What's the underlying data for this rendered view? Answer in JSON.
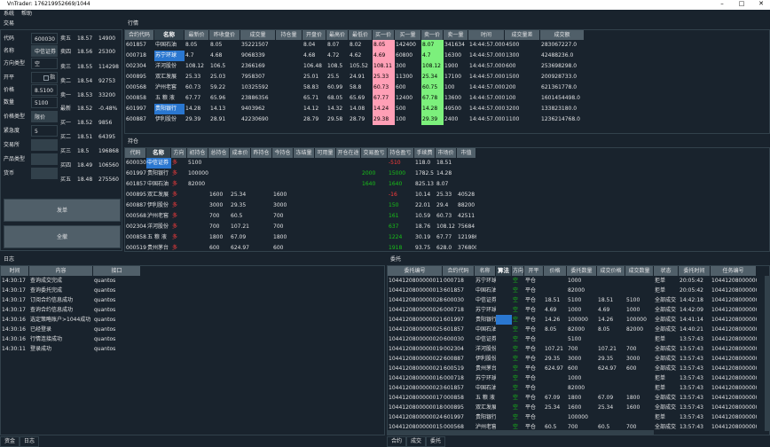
{
  "window": {
    "title": "VnTrader: 176219952669/1044",
    "min": "–",
    "max": "□",
    "close": "✕"
  },
  "menu": {
    "items": [
      "系统",
      "帮助"
    ]
  },
  "trade_panel": {
    "title": "交易",
    "fields": [
      {
        "label": "代码",
        "value": "600030"
      },
      {
        "label": "名称",
        "value": "中信证券"
      },
      {
        "label": "方向类型",
        "value": "空"
      },
      {
        "label": "开平",
        "value": "",
        "checkbox": "指"
      },
      {
        "label": "价格",
        "value": "8.5100"
      },
      {
        "label": "数量",
        "value": "5100"
      },
      {
        "label": "价格类型",
        "value": "限价"
      },
      {
        "label": "紧急度",
        "value": "5"
      },
      {
        "label": "交易所",
        "value": ""
      },
      {
        "label": "产品类型",
        "value": ""
      },
      {
        "label": "货币",
        "value": ""
      }
    ],
    "quotes": [
      {
        "name": "卖五",
        "price": "18.57",
        "vol": "14900"
      },
      {
        "name": "卖四",
        "price": "18.56",
        "vol": "25300"
      },
      {
        "name": "卖三",
        "price": "18.55",
        "vol": "114298"
      },
      {
        "name": "卖二",
        "price": "18.54",
        "vol": "92753"
      },
      {
        "name": "卖一",
        "price": "18.53",
        "vol": "33200"
      },
      {
        "name": "最新",
        "price": "18.52",
        "vol": "-0.48%"
      },
      {
        "name": "买一",
        "price": "18.52",
        "vol": "9856"
      },
      {
        "name": "买二",
        "price": "18.51",
        "vol": "64395"
      },
      {
        "name": "买三",
        "price": "18.5",
        "vol": "196868"
      },
      {
        "name": "买四",
        "price": "18.49",
        "vol": "106560"
      },
      {
        "name": "买五",
        "price": "18.48",
        "vol": "275560"
      }
    ],
    "send_button": "发单",
    "cancel_all_button": "全撤"
  },
  "market": {
    "title": "行情",
    "headers": [
      "合约代码",
      "名称",
      "最新价",
      "昨收盘价",
      "成交量",
      "持仓量",
      "开盘价",
      "最高价",
      "最低价",
      "买一价",
      "买一量",
      "卖一价",
      "卖一量",
      "时间",
      "成交量差",
      "成交额"
    ],
    "rows": [
      [
        "601857",
        "中国石油",
        "8.05",
        "8.05",
        "35221507",
        "",
        "8.04",
        "8.07",
        "8.02",
        "8.05",
        "142400",
        "8.07",
        "341634",
        "14:44:57.000",
        "4500",
        "283067227.0"
      ],
      [
        "000718",
        "苏宁环球",
        "4.7",
        "4.68",
        "9068339",
        "",
        "4.68",
        "4.72",
        "4.62",
        "4.69",
        "60800",
        "4.7",
        "16300",
        "14:44:57.000",
        "1300",
        "42488236.0"
      ],
      [
        "002304",
        "洋河股份",
        "108.12",
        "106.5",
        "2366169",
        "",
        "106.48",
        "108.5",
        "105.52",
        "108.11",
        "300",
        "108.12",
        "1900",
        "14:44:57.000",
        "600",
        "253698298.0"
      ],
      [
        "000895",
        "双汇发展",
        "25.33",
        "25.03",
        "7958307",
        "",
        "25.01",
        "25.5",
        "24.91",
        "25.33",
        "11300",
        "25.34",
        "17100",
        "14:44:57.000",
        "1500",
        "200928733.0"
      ],
      [
        "000568",
        "泸州老窖",
        "60.73",
        "59.22",
        "10325592",
        "",
        "58.83",
        "60.99",
        "58.8",
        "60.73",
        "600",
        "60.75",
        "100",
        "14:44:57.000",
        "200",
        "621361778.0"
      ],
      [
        "000858",
        "五 粮 液",
        "67.77",
        "65.96",
        "23886356",
        "",
        "65.71",
        "68.05",
        "65.69",
        "67.77",
        "12400",
        "67.78",
        "13600",
        "14:44:57.000",
        "100",
        "1601454498.0"
      ],
      [
        "601997",
        "贵阳银行",
        "14.28",
        "14.13",
        "9403962",
        "",
        "14.12",
        "14.32",
        "14.08",
        "14.24",
        "500",
        "14.28",
        "49500",
        "14:44:57.000",
        "3200",
        "133823180.0"
      ],
      [
        "600887",
        "伊利股份",
        "29.39",
        "28.91",
        "42230690",
        "",
        "28.79",
        "29.58",
        "28.79",
        "29.38",
        "100",
        "29.39",
        "2400",
        "14:44:57.000",
        "1100",
        "1236214768.0"
      ]
    ]
  },
  "positions": {
    "title": "持仓",
    "headers": [
      "代码",
      "名称",
      "方向",
      "初持仓",
      "总持仓",
      "成本价",
      "昨持仓",
      "今持仓",
      "冻结量",
      "可用量",
      "开仓在途",
      "交易盈亏",
      "持仓盈亏",
      "手续费",
      "市场价",
      "市值"
    ],
    "rows": [
      [
        "600030",
        "中信证券",
        "多",
        "5100",
        "",
        "",
        "",
        "",
        "",
        "",
        "",
        "",
        "-510",
        "118.0",
        "18.51",
        ""
      ],
      [
        "601997",
        "贵阳银行",
        "多",
        "100000",
        "",
        "",
        "",
        "",
        "",
        "",
        "",
        "2000",
        "15000",
        "1782.5",
        "14.28",
        ""
      ],
      [
        "601857",
        "中国石油",
        "多",
        "82000",
        "",
        "",
        "",
        "",
        "",
        "",
        "",
        "1640",
        "1640",
        "825.13",
        "8.07",
        ""
      ],
      [
        "000895",
        "双汇发展",
        "多",
        "",
        "1600",
        "25.34",
        "",
        "1600",
        "",
        "",
        "",
        "",
        "-16",
        "10.14",
        "25.33",
        "40528"
      ],
      [
        "600887",
        "伊利股份",
        "多",
        "",
        "3000",
        "29.35",
        "",
        "3000",
        "",
        "",
        "",
        "",
        "150",
        "22.01",
        "29.4",
        "88200"
      ],
      [
        "000568",
        "泸州老窖",
        "多",
        "",
        "700",
        "60.5",
        "",
        "700",
        "",
        "",
        "",
        "",
        "161",
        "10.59",
        "60.73",
        "42511"
      ],
      [
        "002304",
        "洋河股份",
        "多",
        "",
        "700",
        "107.21",
        "",
        "700",
        "",
        "",
        "",
        "",
        "637",
        "18.76",
        "108.12",
        "75684"
      ],
      [
        "000858",
        "五 粮 液",
        "多",
        "",
        "1800",
        "67.09",
        "",
        "1800",
        "",
        "",
        "",
        "",
        "1224",
        "30.19",
        "67.77",
        "121986"
      ],
      [
        "000519",
        "贵州茅台",
        "多",
        "",
        "600",
        "624.97",
        "",
        "600",
        "",
        "",
        "",
        "",
        "1918",
        "93.75",
        "628.0",
        "376800"
      ]
    ]
  },
  "log": {
    "title": "日志",
    "headers": [
      "时间",
      "内容",
      "接口"
    ],
    "rows": [
      [
        "14:30:17",
        "查询成交完成",
        "quantos"
      ],
      [
        "14:30:17",
        "查询委托完成",
        "quantos"
      ],
      [
        "14:30:17",
        "订阅合约信息成功",
        "quantos"
      ],
      [
        "14:30:17",
        "查询合约信息成功",
        "quantos"
      ],
      [
        "14:30:16",
        "选定策略账户>1044成功",
        "quantos"
      ],
      [
        "14:30:16",
        "已经登录",
        "quantos"
      ],
      [
        "14:30:16",
        "行情连接成功",
        "quantos"
      ],
      [
        "14:30:11",
        "登录成功",
        "quantos"
      ]
    ],
    "tabs": [
      "资金",
      "日志"
    ]
  },
  "orders": {
    "title": "委托",
    "headers": [
      "委托编号",
      "合约代码",
      "名称",
      "算法",
      "方向",
      "开平",
      "价格",
      "委托数量",
      "成交价格",
      "成交数量",
      "状态",
      "委托时间",
      "任务编号"
    ],
    "rows": [
      [
        "1044120800000011",
        "000718",
        "苏宁环球",
        "",
        "空",
        "平仓",
        "",
        "1000",
        "",
        "",
        "拒单",
        "20:05:42",
        "1044120800000002"
      ],
      [
        "1044120800000013",
        "601857",
        "中国石油",
        "",
        "空",
        "平仓",
        "",
        "82000",
        "",
        "",
        "拒单",
        "20:05:42",
        "1044120800000003"
      ],
      [
        "1044120800000028",
        "600030",
        "中信证券",
        "",
        "空",
        "平仓",
        "18.51",
        "5100",
        "18.51",
        "5100",
        "全部成交",
        "14:42:18",
        "1044120800000007"
      ],
      [
        "1044120800000026",
        "000718",
        "苏宁环球",
        "",
        "空",
        "平仓",
        "4.69",
        "1000",
        "4.69",
        "1000",
        "全部成交",
        "14:42:09",
        "1044120800000006"
      ],
      [
        "1044120800000021",
        "601997",
        "贵阳银行",
        "",
        "空",
        "平仓",
        "14.26",
        "100000",
        "14.26",
        "100000",
        "全部成交",
        "14:41:14",
        "1044120800000004"
      ],
      [
        "1044120800000025",
        "601857",
        "中国石油",
        "",
        "空",
        "平仓",
        "8.05",
        "82000",
        "8.05",
        "82000",
        "全部成交",
        "14:40:21",
        "1044120800000005"
      ],
      [
        "1044120800000020",
        "600030",
        "中信证券",
        "",
        "空",
        "平仓",
        "",
        "5100",
        "",
        "",
        "拒单",
        "13:57:43",
        "1044120800000001"
      ],
      [
        "1044120800000019",
        "002304",
        "洋河股份",
        "",
        "空",
        "平仓",
        "107.21",
        "700",
        "107.21",
        "700",
        "全部成交",
        "13:57:43",
        "1044120800000001"
      ],
      [
        "1044120800000022",
        "600887",
        "伊利股份",
        "",
        "空",
        "平仓",
        "29.35",
        "3000",
        "29.35",
        "3000",
        "全部成交",
        "13:57:43",
        "1044120800000001"
      ],
      [
        "1044120800000021",
        "600519",
        "贵州茅台",
        "",
        "空",
        "平仓",
        "624.97",
        "600",
        "624.97",
        "600",
        "全部成交",
        "13:57:43",
        "1044120800000001"
      ],
      [
        "1044120800000016",
        "000718",
        "苏宁环球",
        "",
        "空",
        "平仓",
        "",
        "1000",
        "",
        "",
        "拒单",
        "13:57:43",
        "1044120800000001"
      ],
      [
        "1044120800000023",
        "601857",
        "中国石油",
        "",
        "空",
        "平仓",
        "",
        "82000",
        "",
        "",
        "拒单",
        "13:57:43",
        "1044120800000001"
      ],
      [
        "1044120800000017",
        "000858",
        "五 粮 液",
        "",
        "空",
        "平仓",
        "67.09",
        "1800",
        "67.09",
        "1800",
        "全部成交",
        "13:57:43",
        "1044120800000001"
      ],
      [
        "1044120800000018",
        "000895",
        "双汇发展",
        "",
        "空",
        "平仓",
        "25.34",
        "1600",
        "25.34",
        "1600",
        "全部成交",
        "13:57:43",
        "1044120800000001"
      ],
      [
        "1044120800000024",
        "601997",
        "贵阳银行",
        "",
        "空",
        "平仓",
        "",
        "100000",
        "",
        "",
        "拒单",
        "13:57:43",
        "1044120800000001"
      ],
      [
        "1044120800000015",
        "000568",
        "泸州老窖",
        "",
        "空",
        "平仓",
        "60.5",
        "700",
        "60.5",
        "700",
        "全部成交",
        "13:57:43",
        "1044120800000001"
      ]
    ],
    "tabs": [
      "合约",
      "成交",
      "委托"
    ]
  },
  "colors": {
    "up": "#ff3b3b",
    "down": "#18c218",
    "bid_bg": "#ff9fb6",
    "ask_bg": "#7cf07c",
    "select": "#2a77d0"
  }
}
